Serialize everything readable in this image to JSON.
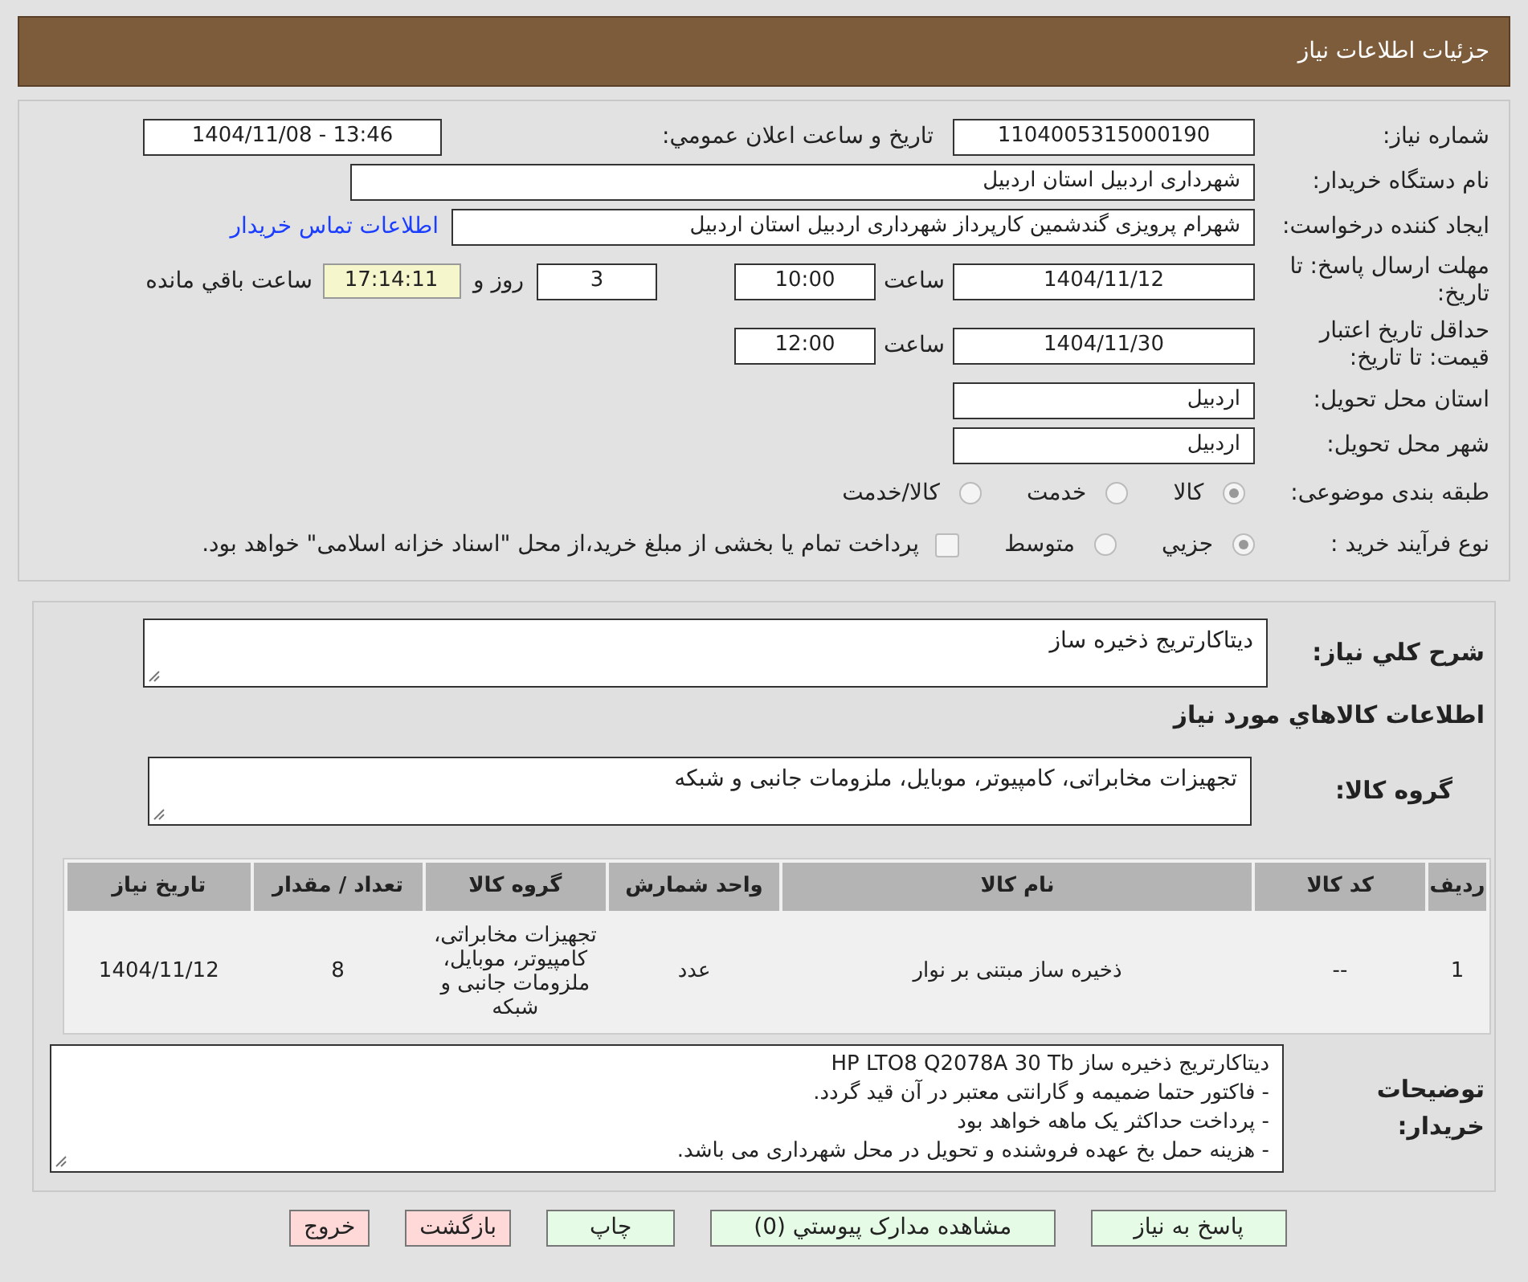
{
  "header": {
    "title": "جزئیات اطلاعات نیاز"
  },
  "fields": {
    "need_number": {
      "label": "شماره نیاز:",
      "value": "1104005315000190"
    },
    "announce": {
      "label": "تاریخ و ساعت اعلان عمومي:",
      "value": "1404/11/08 - 13:46"
    },
    "buyer": {
      "label": "نام دستگاه خریدار:",
      "value": "شهرداری اردبیل استان اردبیل"
    },
    "creator": {
      "label": "ایجاد کننده درخواست:",
      "value": "شهرام پرویزی گندشمین کارپرداز شهرداری اردبیل استان اردبیل",
      "link": "اطلاعات تماس خریدار"
    },
    "deadline": {
      "label": "مهلت ارسال پاسخ: تا تاریخ:",
      "date": "1404/11/12",
      "time_label": "ساعت",
      "time": "10:00",
      "days": "3",
      "days_label": "روز و",
      "remaining": "17:14:11",
      "remaining_label": "ساعت باقي مانده"
    },
    "validity": {
      "label": "حداقل تاریخ اعتبار قیمت: تا تاریخ:",
      "date": "1404/11/30",
      "time_label": "ساعت",
      "time": "12:00"
    },
    "province": {
      "label": "استان محل تحویل:",
      "value": "اردبیل"
    },
    "city": {
      "label": "شهر محل تحویل:",
      "value": "اردبیل"
    },
    "category": {
      "label": "طبقه بندی موضوعی:",
      "options": [
        {
          "label": "کالا",
          "selected": true
        },
        {
          "label": "خدمت",
          "selected": false
        },
        {
          "label": "کالا/خدمت",
          "selected": false
        }
      ]
    },
    "process": {
      "label": "نوع فرآیند خرید :",
      "options": [
        {
          "label": "جزيي",
          "selected": true
        },
        {
          "label": "متوسط",
          "selected": false
        }
      ],
      "treasury": {
        "checked": false,
        "label": "پرداخت تمام یا بخشی از مبلغ خرید،از محل \"اسناد خزانه اسلامی\" خواهد بود."
      }
    }
  },
  "summary": {
    "label": "شرح کلي نیاز:",
    "value": "دیتاکارتریج ذخیره ساز"
  },
  "goods_heading": "اطلاعات کالاهاي مورد نیاز",
  "goods_group": {
    "label": "گروه کالا:",
    "value": "تجهیزات مخابراتی، کامپیوتر، موبایل، ملزومات جانبی و شبکه"
  },
  "table": {
    "columns": [
      "ردیف",
      "کد کالا",
      "نام کالا",
      "واحد شمارش",
      "گروه کالا",
      "تعداد / مقدار",
      "تاریخ نیاز"
    ],
    "rows": [
      [
        "1",
        "--",
        "ذخیره ساز مبتنی بر نوار",
        "عدد",
        "تجهیزات مخابراتی، کامپیوتر، موبایل، ملزومات جانبی و شبکه",
        "8",
        "1404/11/12"
      ]
    ]
  },
  "notes": {
    "label": "توضیحات خریدار:",
    "lines": [
      "دیتاکارتریج ذخیره ساز HP LTO8  Q2078A 30 Tb",
      "- فاکتور حتما ضمیمه و گارانتی معتبر در آن قید گردد.",
      "- پرداخت حداکثر یک ماهه خواهد بود",
      "- هزینه حمل بخ عهده فروشنده و تحویل در محل شهرداری می باشد."
    ]
  },
  "buttons": [
    {
      "label": "پاسخ به نیاز",
      "kind": "action"
    },
    {
      "label": "مشاهده مدارک پیوستي (0)",
      "kind": "action"
    },
    {
      "label": "چاپ",
      "kind": "action"
    },
    {
      "label": "بازگشت",
      "kind": "exit"
    },
    {
      "label": "خروج",
      "kind": "exit"
    }
  ]
}
